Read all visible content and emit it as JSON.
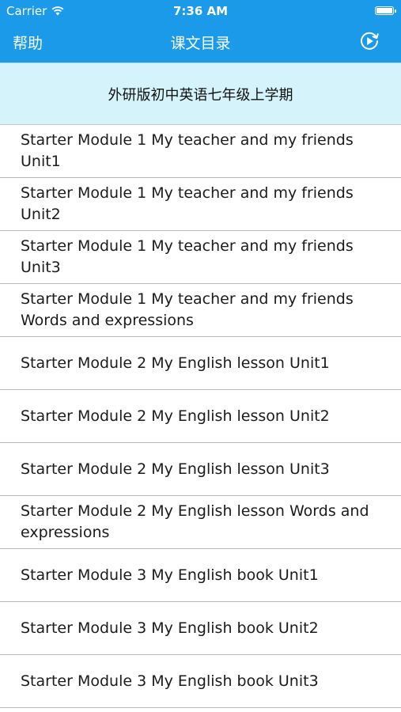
{
  "status_bar": {
    "carrier": "Carrier",
    "time": "7:36 AM"
  },
  "nav": {
    "left_label": "帮助",
    "title": "课文目录",
    "right_icon": "play-circle-icon"
  },
  "section_header": "外研版初中英语七年级上学期",
  "items": [
    {
      "label": "Starter Module 1 My teacher and my friends Unit1"
    },
    {
      "label": "Starter Module 1 My teacher and my friends Unit2"
    },
    {
      "label": "Starter Module 1 My teacher and my friends Unit3"
    },
    {
      "label": "Starter Module 1 My teacher and my friends Words and expressions"
    },
    {
      "label": "Starter Module 2 My English lesson  Unit1"
    },
    {
      "label": "Starter Module 2 My English lesson  Unit2"
    },
    {
      "label": "Starter Module 2 My English lesson  Unit3"
    },
    {
      "label": "Starter Module 2 My English lesson  Words and expressions"
    },
    {
      "label": "Starter Module 3 My English book  Unit1"
    },
    {
      "label": "Starter Module 3 My English book  Unit2"
    },
    {
      "label": "Starter Module 3 My English book  Unit3"
    }
  ],
  "colors": {
    "nav_bg": "#1a9ae8",
    "header_bg": "#d5f3fb"
  }
}
